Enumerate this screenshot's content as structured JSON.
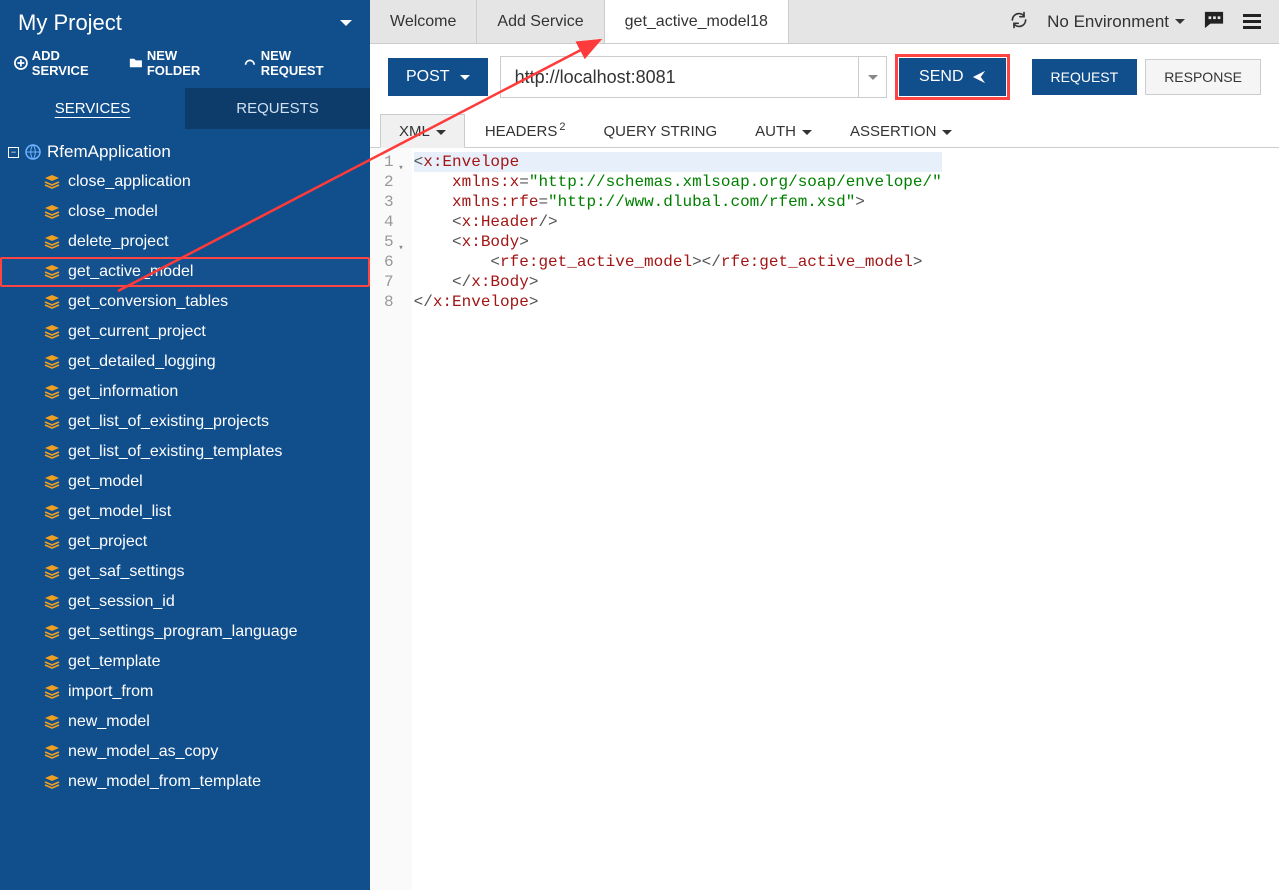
{
  "sidebar": {
    "project_title": "My Project",
    "actions": {
      "add_service": "ADD SERVICE",
      "new_folder": "NEW FOLDER",
      "new_request": "NEW REQUEST"
    },
    "tabs": {
      "services": "SERVICES",
      "requests": "REQUESTS"
    },
    "root_name": "RfemApplication",
    "items": [
      "close_application",
      "close_model",
      "delete_project",
      "get_active_model",
      "get_conversion_tables",
      "get_current_project",
      "get_detailed_logging",
      "get_information",
      "get_list_of_existing_projects",
      "get_list_of_existing_templates",
      "get_model",
      "get_model_list",
      "get_project",
      "get_saf_settings",
      "get_session_id",
      "get_settings_program_language",
      "get_template",
      "import_from",
      "new_model",
      "new_model_as_copy",
      "new_model_from_template"
    ],
    "highlighted_index": 3
  },
  "topbar": {
    "tabs": [
      "Welcome",
      "Add Service",
      "get_active_model18"
    ],
    "active_tab_index": 2,
    "env_label": "No Environment"
  },
  "request": {
    "method": "POST",
    "url": "http://localhost:8081",
    "send_label": "SEND",
    "tabs": {
      "request": "REQUEST",
      "response": "RESPONSE"
    }
  },
  "subtabs": {
    "xml": "XML",
    "headers": "HEADERS",
    "headers_badge": "2",
    "query": "QUERY STRING",
    "auth": "AUTH",
    "assertion": "ASSERTION"
  },
  "code": {
    "ns_soap": "http://schemas.xmlsoap.org/soap/envelope/",
    "ns_rfe": "http://www.dlubal.com/rfem.xsd"
  }
}
